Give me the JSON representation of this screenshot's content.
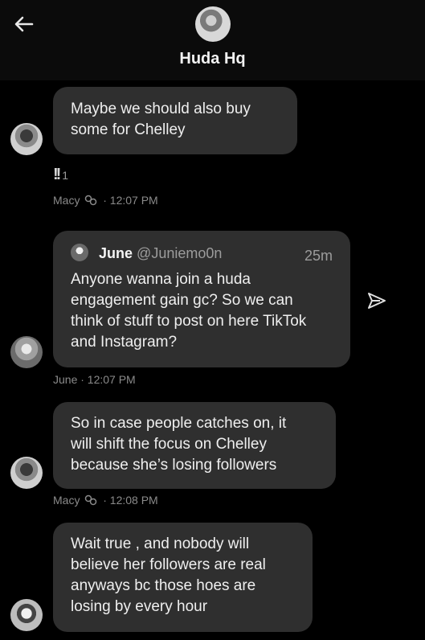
{
  "header": {
    "back_icon": "arrow-left-icon",
    "title": "Huda Hq"
  },
  "messages": [
    {
      "sender": "Macy",
      "text_lines": [
        "Maybe we should also buy",
        "some for Chelley"
      ],
      "reaction": {
        "icon": "double-exclamation-icon",
        "count": "1"
      },
      "time": "· 12:07 PM"
    },
    {
      "sender": "June",
      "quote": {
        "name": "June",
        "handle": "@Juniemo0n",
        "age": "25m",
        "text_lines": [
          "Anyone wanna join a huda",
          "engagement gain gc? So we can",
          "think of stuff to post on here TikTok",
          "and Instagram?"
        ]
      },
      "time": "June · 12:07 PM"
    },
    {
      "sender": "Macy",
      "text_lines": [
        "So in case people catches on, it",
        "will shift the focus on Chelley",
        "because she’s losing followers"
      ],
      "time": "· 12:08 PM"
    },
    {
      "sender": "",
      "text_lines": [
        "Wait true , and nobody will",
        "believe her followers are real",
        "anyways bc those hoes are",
        "losing by every hour"
      ]
    }
  ],
  "colors": {
    "background": "#000000",
    "bubble": "#2f2f2f",
    "meta_text": "#8a8a8a"
  }
}
